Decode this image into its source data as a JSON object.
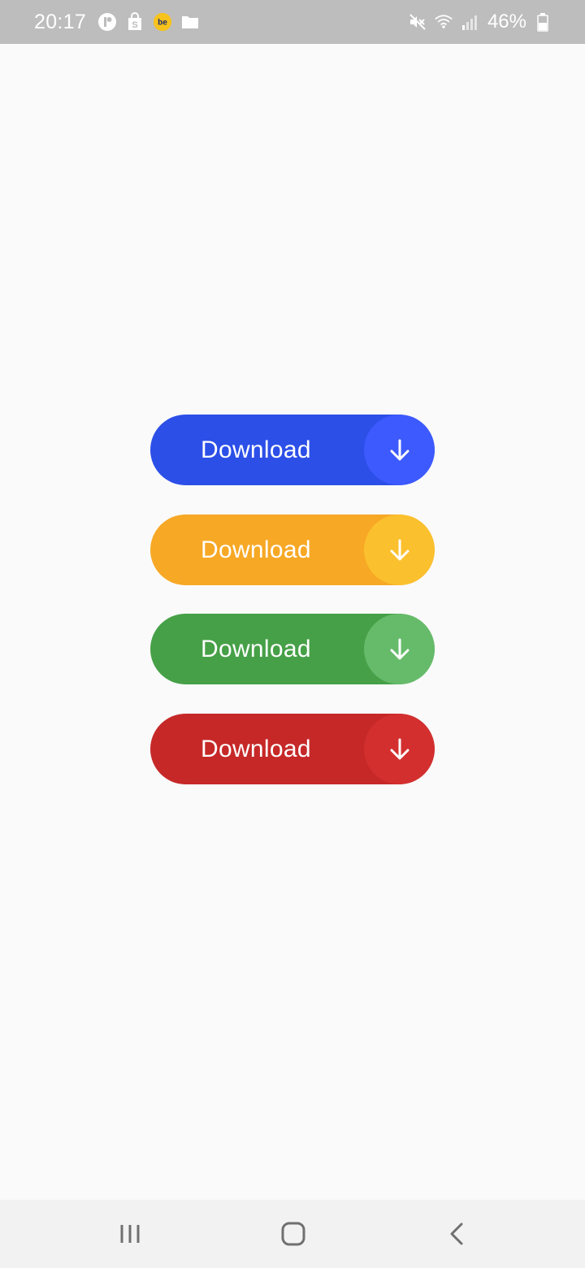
{
  "status_bar": {
    "time": "20:17",
    "battery_percent": "46%",
    "left_icons": [
      "podcast-icon",
      "shopping-bag-icon",
      "be-app-icon",
      "folder-icon"
    ],
    "right_icons": [
      "mute-icon",
      "wifi-icon",
      "signal-icon",
      "battery-icon"
    ]
  },
  "buttons": [
    {
      "label": "Download",
      "color": "#2c4fe8",
      "circle_color": "#3d5afe",
      "icon": "arrow-down-icon"
    },
    {
      "label": "Download",
      "color": "#f7a825",
      "circle_color": "#fbc02d",
      "icon": "arrow-down-icon"
    },
    {
      "label": "Download",
      "color": "#46a047",
      "circle_color": "#66bb6a",
      "icon": "arrow-down-icon"
    },
    {
      "label": "Download",
      "color": "#c62828",
      "circle_color": "#d32f2f",
      "icon": "arrow-down-icon"
    }
  ],
  "nav_bar": {
    "buttons": [
      "recent-apps-icon",
      "home-icon",
      "back-icon"
    ]
  },
  "colors": {
    "background": "#fafafa",
    "status_bar": "#bdbdbd",
    "nav_bar": "#f2f2f2"
  }
}
